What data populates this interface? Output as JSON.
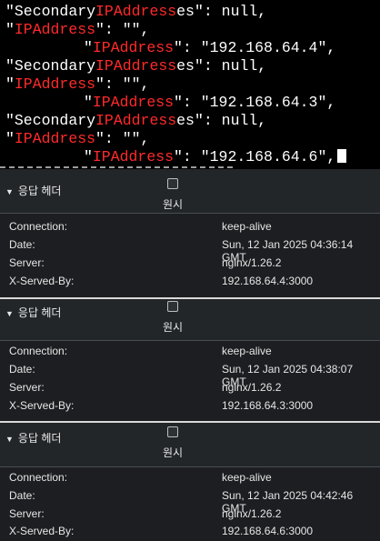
{
  "terminal": {
    "lines": [
      {
        "indent": false,
        "q": "\"",
        "a": "Secondary",
        "h": "IPAddress",
        "b": "es\": null,"
      },
      {
        "indent": false,
        "q": "\"",
        "a": "",
        "h": "IPAddress",
        "b": "\": \"\","
      },
      {
        "indent": true,
        "q": "\"",
        "a": "",
        "h": "IPAddress",
        "b": "\": \"192.168.64.4\","
      },
      {
        "indent": false,
        "q": "\"",
        "a": "Secondary",
        "h": "IPAddress",
        "b": "es\": null,"
      },
      {
        "indent": false,
        "q": "\"",
        "a": "",
        "h": "IPAddress",
        "b": "\": \"\","
      },
      {
        "indent": true,
        "q": "\"",
        "a": "",
        "h": "IPAddress",
        "b": "\": \"192.168.64.3\","
      },
      {
        "indent": false,
        "q": "\"",
        "a": "Secondary",
        "h": "IPAddress",
        "b": "es\": null,"
      },
      {
        "indent": false,
        "q": "\"",
        "a": "",
        "h": "IPAddress",
        "b": "\": \"\","
      },
      {
        "indent": true,
        "q": "\"",
        "a": "",
        "h": "IPAddress",
        "b": "\": \"192.168.64.6\","
      }
    ]
  },
  "panels": [
    {
      "title": "응답 헤더",
      "raw_label": "원시",
      "headers": [
        {
          "key": "Connection:",
          "value": "keep-alive"
        },
        {
          "key": "Date:",
          "value": "Sun, 12 Jan 2025 04:36:14 GMT"
        },
        {
          "key": "Server:",
          "value": "nginx/1.26.2"
        },
        {
          "key": "X-Served-By:",
          "value": "192.168.64.4:3000"
        }
      ]
    },
    {
      "title": "응답 헤더",
      "raw_label": "원시",
      "headers": [
        {
          "key": "Connection:",
          "value": "keep-alive"
        },
        {
          "key": "Date:",
          "value": "Sun, 12 Jan 2025 04:38:07 GMT"
        },
        {
          "key": "Server:",
          "value": "nginx/1.26.2"
        },
        {
          "key": "X-Served-By:",
          "value": "192.168.64.3:3000"
        }
      ]
    },
    {
      "title": "응답 헤더",
      "raw_label": "원시",
      "headers": [
        {
          "key": "Connection:",
          "value": "keep-alive"
        },
        {
          "key": "Date:",
          "value": "Sun, 12 Jan 2025 04:42:46 GMT"
        },
        {
          "key": "Server:",
          "value": "nginx/1.26.2"
        },
        {
          "key": "X-Served-By:",
          "value": "192.168.64.6:3000"
        }
      ]
    }
  ]
}
